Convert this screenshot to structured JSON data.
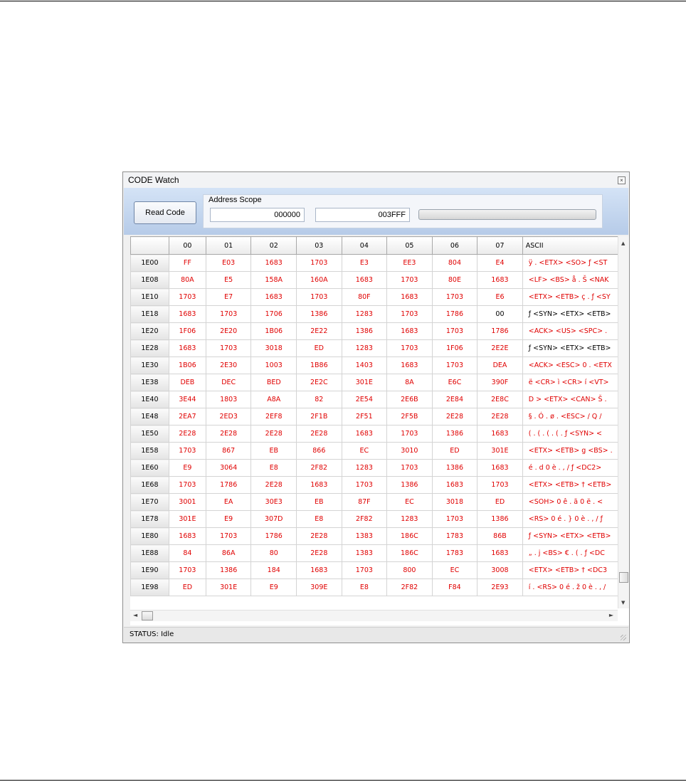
{
  "window": {
    "title": "CODE Watch",
    "close_glyph": "×"
  },
  "toolbar": {
    "read_code_label": "Read Code",
    "address_scope_label": "Address Scope",
    "start_address": "000000",
    "end_address": "003FFF"
  },
  "grid": {
    "headers": [
      "",
      "00",
      "01",
      "02",
      "03",
      "04",
      "05",
      "06",
      "07",
      "ASCII"
    ],
    "rows": [
      {
        "addr": "1E00",
        "cells": [
          "FF",
          "E03",
          "1683",
          "1703",
          "E3",
          "EE3",
          "804",
          "E4"
        ],
        "ascii": "ÿ . <ETX> <SO> ƒ <ST"
      },
      {
        "addr": "1E08",
        "cells": [
          "80A",
          "E5",
          "158A",
          "160A",
          "1683",
          "1703",
          "80E",
          "1683"
        ],
        "ascii": "<LF> <BS> å . Š <NAK"
      },
      {
        "addr": "1E10",
        "cells": [
          "1703",
          "E7",
          "1683",
          "1703",
          "80F",
          "1683",
          "1703",
          "E6"
        ],
        "ascii": "<ETX> <ETB> ç . ƒ <SY"
      },
      {
        "addr": "1E18",
        "cells": [
          "1683",
          "1703",
          "1706",
          "1386",
          "1283",
          "1703",
          "1786",
          "00"
        ],
        "ascii": "ƒ <SYN> <ETX> <ETB>"
      },
      {
        "addr": "1E20",
        "cells": [
          "1F06",
          "2E20",
          "1B06",
          "2E22",
          "1386",
          "1683",
          "1703",
          "1786"
        ],
        "ascii": "<ACK> <US> <SPC> ."
      },
      {
        "addr": "1E28",
        "cells": [
          "1683",
          "1703",
          "3018",
          "ED",
          "1283",
          "1703",
          "1F06",
          "2E2E"
        ],
        "ascii": "ƒ <SYN> <ETX> <ETB>"
      },
      {
        "addr": "1E30",
        "cells": [
          "1B06",
          "2E30",
          "1003",
          "1B86",
          "1403",
          "1683",
          "1703",
          "DEA"
        ],
        "ascii": "<ACK> <ESC> 0 . <ETX"
      },
      {
        "addr": "1E38",
        "cells": [
          "DEB",
          "DEC",
          "BED",
          "2E2C",
          "301E",
          "8A",
          "E6C",
          "390F"
        ],
        "ascii": "ë <CR> ì <CR> í <VT>"
      },
      {
        "addr": "1E40",
        "cells": [
          "3E44",
          "1803",
          "A8A",
          "82",
          "2E54",
          "2E6B",
          "2E84",
          "2E8C"
        ],
        "ascii": "D > <ETX> <CAN> Š ."
      },
      {
        "addr": "1E48",
        "cells": [
          "2EA7",
          "2ED3",
          "2EF8",
          "2F1B",
          "2F51",
          "2F5B",
          "2E28",
          "2E28"
        ],
        "ascii": "§ . Ó . ø . <ESC> / Q /"
      },
      {
        "addr": "1E50",
        "cells": [
          "2E28",
          "2E28",
          "2E28",
          "2E28",
          "1683",
          "1703",
          "1386",
          "1683"
        ],
        "ascii": "( . ( . ( . ( . ƒ <SYN> <"
      },
      {
        "addr": "1E58",
        "cells": [
          "1703",
          "867",
          "EB",
          "866",
          "EC",
          "3010",
          "ED",
          "301E"
        ],
        "ascii": "<ETX> <ETB> g <BS> ."
      },
      {
        "addr": "1E60",
        "cells": [
          "E9",
          "3064",
          "E8",
          "2F82",
          "1283",
          "1703",
          "1386",
          "1683"
        ],
        "ascii": "é . d 0 è . , / ƒ <DC2>"
      },
      {
        "addr": "1E68",
        "cells": [
          "1703",
          "1786",
          "2E28",
          "1683",
          "1703",
          "1386",
          "1683",
          "1703"
        ],
        "ascii": "<ETX> <ETB> † <ETB>"
      },
      {
        "addr": "1E70",
        "cells": [
          "3001",
          "EA",
          "30E3",
          "EB",
          "87F",
          "EC",
          "3018",
          "ED"
        ],
        "ascii": "<SOH> 0 ê . ã 0 ë . <"
      },
      {
        "addr": "1E78",
        "cells": [
          "301E",
          "E9",
          "307D",
          "E8",
          "2F82",
          "1283",
          "1703",
          "1386"
        ],
        "ascii": "<RS> 0 é . } 0 è . , / ƒ"
      },
      {
        "addr": "1E80",
        "cells": [
          "1683",
          "1703",
          "1786",
          "2E28",
          "1383",
          "186C",
          "1783",
          "86B"
        ],
        "ascii": "ƒ <SYN> <ETX> <ETB>"
      },
      {
        "addr": "1E88",
        "cells": [
          "84",
          "86A",
          "80",
          "2E28",
          "1383",
          "186C",
          "1783",
          "1683"
        ],
        "ascii": "„ . j <BS> € . ( . ƒ <DC"
      },
      {
        "addr": "1E90",
        "cells": [
          "1703",
          "1386",
          "184",
          "1683",
          "1703",
          "800",
          "EC",
          "3008"
        ],
        "ascii": "<ETX> <ETB> † <DC3"
      },
      {
        "addr": "1E98",
        "cells": [
          "ED",
          "301E",
          "E9",
          "309E",
          "E8",
          "2F82",
          "F84",
          "2E93"
        ],
        "ascii": "í . <RS> 0 é . ž 0 è . , /"
      }
    ]
  },
  "status": {
    "text": "STATUS: Idle"
  },
  "colors": {
    "changed_value": "#e00000",
    "unchanged_value": "#000000",
    "toolbar_top": "#d4e3f6",
    "toolbar_bottom": "#b6cbe8"
  },
  "icons": {
    "close": "close-icon",
    "scroll_up": "scroll-up-arrow-icon",
    "scroll_down": "scroll-down-arrow-icon",
    "scroll_left": "scroll-left-arrow-icon",
    "scroll_right": "scroll-right-arrow-icon"
  }
}
